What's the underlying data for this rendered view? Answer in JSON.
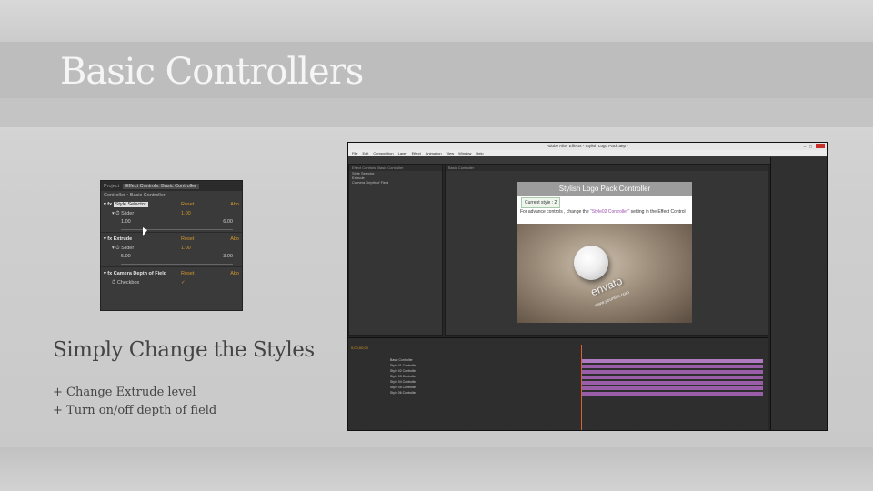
{
  "slide": {
    "title": "Basic Controllers",
    "subtitle": "Simply Change the Styles",
    "bullets": [
      "+ Change Extrude level",
      "+ Turn on/off depth of field"
    ]
  },
  "effect_controls": {
    "tab_project": "Project",
    "tab_active": "Effect Controls: Basic Controller",
    "breadcrumb": "Controller • Basic Controller",
    "reset": "Reset",
    "about": "Abo",
    "groups": [
      {
        "name": "Style Selector",
        "slider_label": "Slider",
        "value": "1.00",
        "min": "1.00",
        "max": "6.00"
      },
      {
        "name": "Extrude",
        "slider_label": "Slider",
        "value": "1.00",
        "min": "5.00",
        "max": "3.00"
      },
      {
        "name": "Camera Depth of Field",
        "checkbox_label": "Checkbox",
        "checked": "✓"
      }
    ]
  },
  "ae_window": {
    "title": "Adobe After Effects - Stylish Logo Pack.aep *",
    "menu": [
      "File",
      "Edit",
      "Composition",
      "Layer",
      "Effect",
      "Animation",
      "View",
      "Window",
      "Help"
    ],
    "viewer": {
      "heading": "Stylish Logo Pack Controller",
      "current_style_label": "Current style : 2",
      "advanced_prefix": "For advance controls , change the ",
      "advanced_highlight": "\"Style02 Controller\"",
      "advanced_suffix": " setting in the Effect Control",
      "logo_text": "envato",
      "logo_url": "www.yoursite.com"
    },
    "timeline": {
      "timecode": "0;00;00;00",
      "layers": [
        "Basic Controller",
        "Style 01 Controller",
        "Style 02 Controller",
        "Style 03 Controller",
        "Style 04 Controller",
        "Style 05 Controller",
        "Style 06 Controller"
      ]
    }
  },
  "colors": {
    "accent_orange": "#d49a2a",
    "layer_bar": "#9a5ea8",
    "close_red": "#c9302c"
  }
}
